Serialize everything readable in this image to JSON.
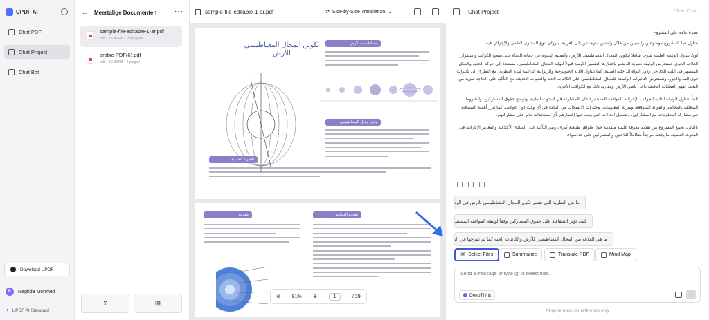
{
  "app": {
    "name": "UPDF AI"
  },
  "sidebar": {
    "items": [
      {
        "label": "Chat PDF",
        "icon": "chat-pdf-icon"
      },
      {
        "label": "Chat Project",
        "icon": "folder-chat-icon"
      },
      {
        "label": "Chat Bot",
        "icon": "bot-icon"
      }
    ],
    "download_label": "Download UPDF",
    "user_name": "Raghda Mohmed",
    "user_initial": "R",
    "plan_label": "UPDF AI Standard"
  },
  "documents": {
    "title": "Meertalige Documenten",
    "files": [
      {
        "name": "sample-file-editable-1-ar.pdf",
        "meta": "pdf · 16.41MB · 29 pages"
      },
      {
        "name": "arabic-PDF(6).pdf",
        "meta": "pdf · 90.89KB · 2 pages"
      }
    ]
  },
  "viewer": {
    "file_name": "sample-file-editable-1-ar.pdf",
    "translation_mode": "Side-by-Side Translation",
    "page1": {
      "title": "تكوين المجال المغناطيسي للأرض",
      "heading1": "مغناطيسية الأرض",
      "heading2": "وقف مجال المغناطيسي",
      "heading3": "الأجزاء الحسية"
    },
    "page2": {
      "heading1": "مقدمة",
      "heading2": "نظرية الدينامو"
    },
    "zoom": "81%",
    "current_page": "1",
    "total_pages": "/ 29"
  },
  "chat": {
    "title": "Chat Project",
    "clear_label": "Clear Chat",
    "answer": [
      "نظرة عامة على المشروع",
      "يتناول هذا المشروع موضوعين رئيسيين من خلال وثيقتين مترجمتين إلى العربية، يبرزان تنوع المحتوى العلمي والإجرائي فيه.",
      "أولاً، تتناول الوثيقة العلمية شرحاً شاملاً لتكوين المجال المغناطيسي للأرض، وأهميته الحيوية في حماية الحياة على سطح الكوكب واستقرار الغلاف الجوي. تستعرض الوثيقة نظرية الدينامو باعتبارها التفسير الأوسع قبولاً لتوليد المجال المغناطيسي، مستندة إلى حركة الحديد والنيكل المنصهر في اللب الخارجي ودور النواة الداخلية الصلبة، كما تتناول الأدلة الجيولوجية والزلزالية الداعمة لهذه النظرية، مع التطرق إلى تأثيرات قوى المد والجزر، وتستعرض التأثيرات الواسعة للمجال المغناطيسي على الكائنات الحية والتقنيات الحديثة، مع التأكيد على الحاجة لمزيد من البحث لفهم العمليات الدقيقة داخل باطن الأرض ومقارنة ذلك مع الكواكب الأخرى.",
      "ثانياً، تتناول الوثيقة الثانية الجوانب الإجرائية للموافقة المستنيرة على المشاركة في البحوث الطبية، وتوضح حقوق المشاركين، والشروط المتعلقة بالمخاطر والفوائد المتوقعة، وسرية المعلومات، وخيارات الانسحاب من البحث في أي وقت دون عواقب. كما تبرز أهمية الشفافية في مشاركة المعلومات مع المشاركين، وتفصيل الحالات التي يجب فيها إخطارهم بأي مستجدات تؤثر على مشاركتهم.",
      "بالتالي، يجمع المشروع بين تقديم معرفة علمية متقدمة حول ظواهر طبيعية كبرى، وبين التأكيد على المبادئ الأخلاقية والمعايير الإجرائية في البحوث العلمية، ما يجعله مرجعاً متكاملاً للباحثين والمشاركين على حد سواء."
    ],
    "suggestions": [
      "ما هي النظرية التي تفسر تكون المجال المغناطيسي للأرض في الوثيقة العلمية؟",
      "كيف تؤثر الشفافية على حقوق المشاركين وفقاً لوثيقة الموافقة المستنيرة؟",
      "ما هي العلاقة بين المجال المغناطيسي للأرض والكائنات الحية كما تم شرحها في الوثيقة العلمية؟"
    ],
    "tools": [
      {
        "label": "Select Files",
        "icon": "at-icon"
      },
      {
        "label": "Summarize",
        "icon": "summarize-icon"
      },
      {
        "label": "Translate PDF",
        "icon": "translate-icon"
      },
      {
        "label": "Mind Map",
        "icon": "mindmap-icon"
      }
    ],
    "input_placeholder": "Send a message or type @ to select files.",
    "deepthink_label": "DeepThink",
    "disclaimer": "AI-generated, for reference only"
  },
  "colors": {
    "accent": "#3a5ad9",
    "brand": "#6a5cff",
    "heading_purple": "#8e7ec7",
    "arrow": "#2f6fe0"
  }
}
